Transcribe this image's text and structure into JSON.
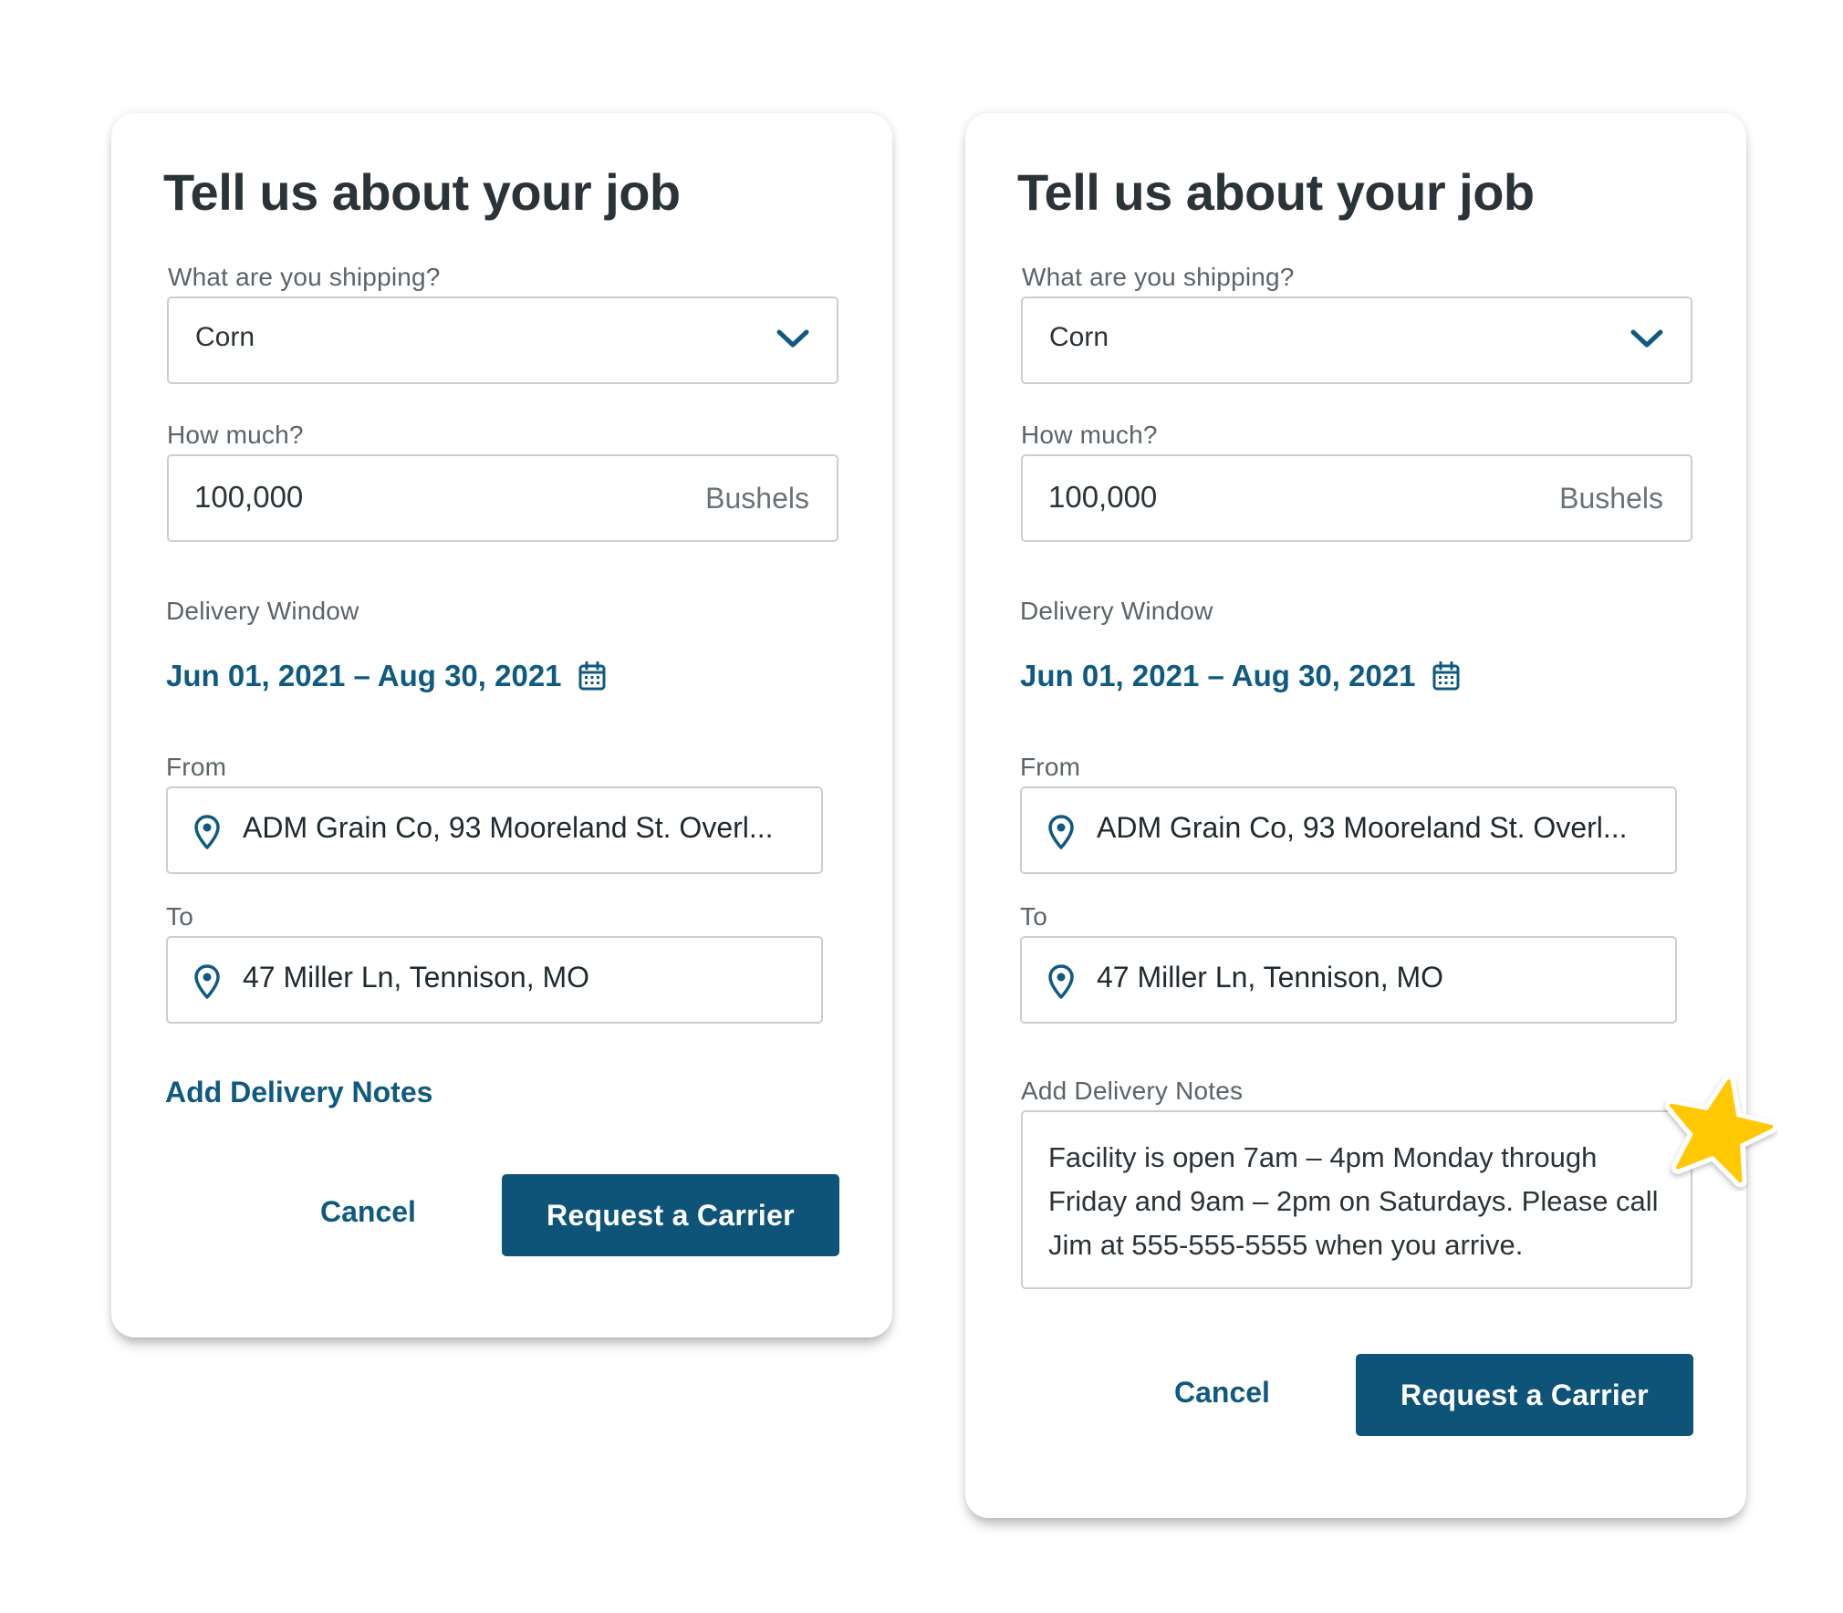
{
  "left_card": {
    "title": "Tell us about your job",
    "shipping_label": "What are you shipping?",
    "shipping_value": "Corn",
    "amount_label": "How much?",
    "amount_value": "100,000",
    "amount_unit": "Bushels",
    "window_label": "Delivery Window",
    "window_value": "Jun 01, 2021 – Aug 30, 2021",
    "from_label": "From",
    "from_value": "ADM Grain Co, 93 Mooreland St. Overl...",
    "to_label": "To",
    "to_value": "47 Miller Ln, Tennison, MO",
    "notes_link": "Add Delivery Notes",
    "cancel_label": "Cancel",
    "submit_label": "Request a Carrier"
  },
  "right_card": {
    "title": "Tell us about your job",
    "shipping_label": "What are you shipping?",
    "shipping_value": "Corn",
    "amount_label": "How much?",
    "amount_value": "100,000",
    "amount_unit": "Bushels",
    "window_label": "Delivery Window",
    "window_value": "Jun 01, 2021 – Aug 30, 2021",
    "from_label": "From",
    "from_value": "ADM Grain Co, 93 Mooreland St. Overl...",
    "to_label": "To",
    "to_value": "47 Miller Ln, Tennison, MO",
    "notes_label": "Add Delivery Notes",
    "notes_value": "Facility is open 7am – 4pm Monday through Friday and 9am – 2pm on Saturdays. Please call Jim at 555-555-5555 when you arrive.",
    "cancel_label": "Cancel",
    "submit_label": "Request a Carrier"
  },
  "icons": {
    "dropdown": "chevron-down-icon",
    "calendar": "calendar-icon",
    "location": "location-pin-icon",
    "highlight": "star-icon"
  },
  "colors": {
    "accent": "#0f5a80",
    "button": "#0e5479",
    "star": "#ffc800",
    "border": "#c8cfd3"
  }
}
